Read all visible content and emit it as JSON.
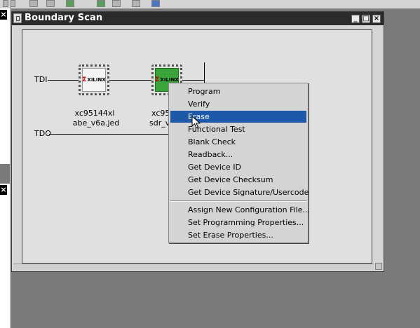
{
  "window": {
    "title": "Boundary Scan"
  },
  "chain": {
    "tdi_label": "TDI",
    "tdo_label": "TDO",
    "devices": [
      {
        "logo": "XILINX",
        "part": "xc95144xl",
        "file": "abe_v6a.jed"
      },
      {
        "logo": "XILINX",
        "part": "xc95",
        "file": "sdr_v"
      }
    ]
  },
  "context_menu": {
    "group1": [
      {
        "label": "Program"
      },
      {
        "label": "Verify"
      },
      {
        "label": "Erase",
        "selected": true
      },
      {
        "label": "Functional Test"
      },
      {
        "label": "Blank Check"
      },
      {
        "label": "Readback..."
      },
      {
        "label": "Get Device ID"
      },
      {
        "label": "Get Device Checksum"
      },
      {
        "label": "Get Device Signature/Usercode"
      }
    ],
    "group2": [
      {
        "label": "Assign New Configuration File..."
      },
      {
        "label": "Set Programming Properties..."
      },
      {
        "label": "Set Erase Properties..."
      }
    ]
  },
  "colors": {
    "titlebar": "#2b2b2b",
    "menu_highlight": "#1e58a8",
    "chip_active": "#3aa33a"
  }
}
